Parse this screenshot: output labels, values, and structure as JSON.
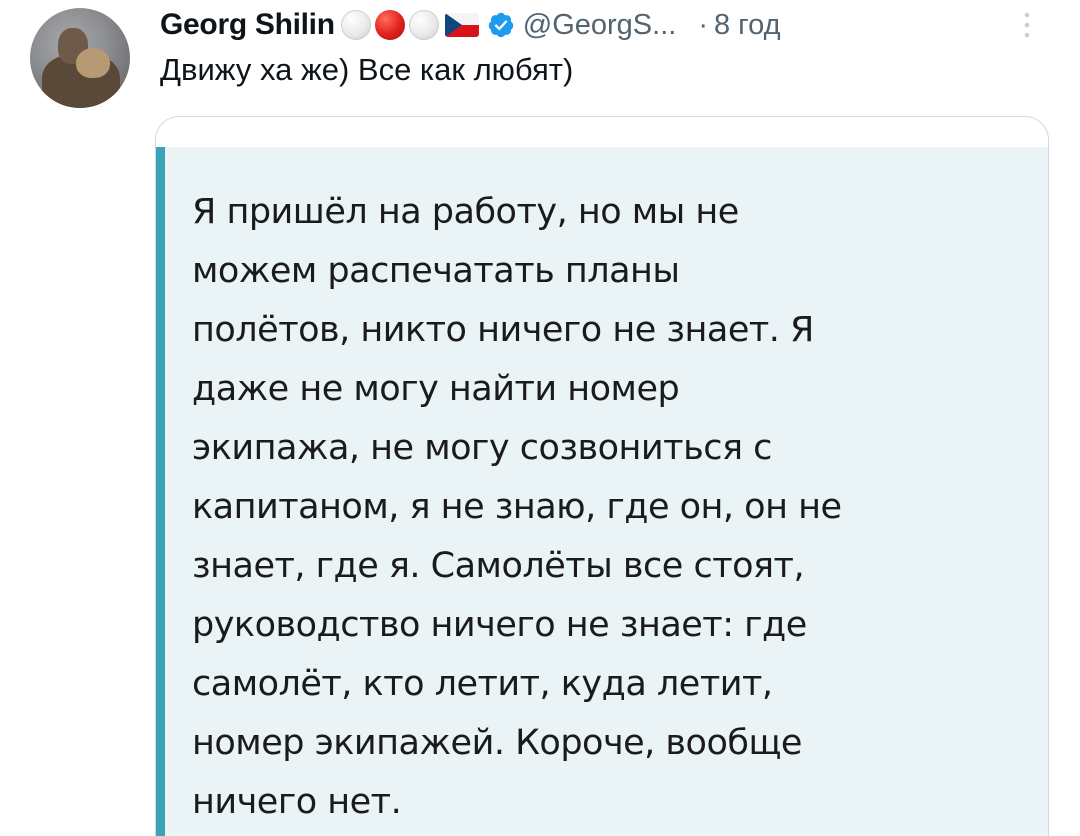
{
  "author": {
    "name": "Georg Shilin",
    "handle": "@GeorgS...",
    "time": "8 год",
    "separator": "·",
    "avatar_icon": "user-avatar",
    "verified_icon": "verified-badge-icon",
    "verified_color": "#1d9bf0"
  },
  "name_emojis": [
    "white-circle",
    "red-circle",
    "white-circle",
    "czech-flag"
  ],
  "tweet": {
    "text": "Движу ха же) Все как любят)"
  },
  "quote": {
    "accent_color": "#3aa3b8",
    "background_color": "#eaf3f6",
    "lines": [
      "Я пришёл на работу, но мы не",
      "можем распечатать планы",
      "полётов, никто ничего не знает. Я",
      "даже не могу найти номер",
      "экипажа, не могу созвониться с",
      "капитаном, я не знаю, где он, он не",
      "знает, где я. Самолёты все стоят,",
      "руководство ничего не знает: где",
      "самолёт, кто летит, куда летит,",
      "номер экипажей. Короче, вообще",
      "ничего нет."
    ]
  }
}
